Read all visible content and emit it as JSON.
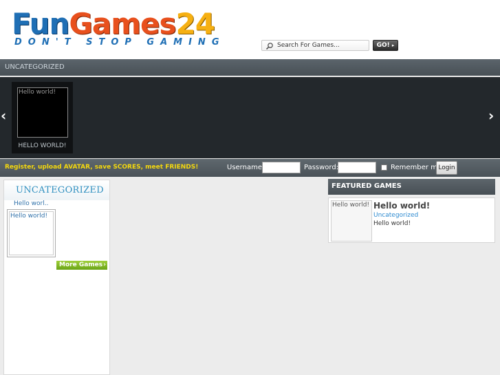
{
  "logo": {
    "part1": "Fun",
    "part2": "Games",
    "part3": "24",
    "tagline": "DON'T STOP GAMING"
  },
  "search": {
    "placeholder": "Search For Games...",
    "button_label": "GO!",
    "icon": "search-icon"
  },
  "nav": {
    "category": "UNCATEGORIZED"
  },
  "slider": {
    "prev_icon": "‹",
    "next_icon": "›",
    "thumb_text": "Hello world!",
    "caption": "HELLO WORLD!"
  },
  "loginbar": {
    "promo": "Register, upload AVATAR, save SCORES, meet FRIENDS!",
    "username_label": "Username:",
    "password_label": "Password:",
    "remember_label": "Remember me",
    "login_button": "Login",
    "promo_color": "#f4d80e"
  },
  "category_box": {
    "title": "UNCATEGORIZED",
    "link": "Hello worl..",
    "thumb_text": "Hello world!",
    "more_button": "More Games"
  },
  "featured": {
    "header": "FEATURED GAMES",
    "thumb_text": "Hello world!",
    "title": "Hello world!",
    "category": "Uncategorized",
    "description": "Hello world!"
  }
}
